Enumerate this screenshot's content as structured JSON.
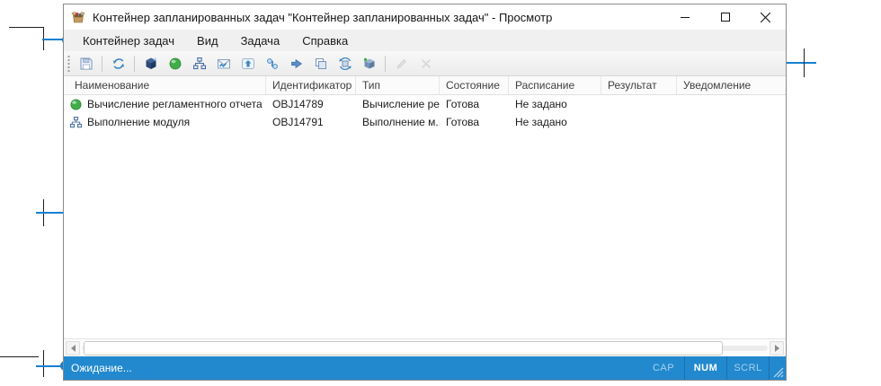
{
  "window": {
    "title": "Контейнер запланированных задач \"Контейнер запланированных задач\" - Просмотр",
    "app_icon": "open-box-icon",
    "controls": [
      "minimize",
      "maximize",
      "close"
    ]
  },
  "menu": {
    "items": [
      "Контейнер задач",
      "Вид",
      "Задача",
      "Справка"
    ]
  },
  "toolbar": {
    "icons": [
      "save-icon",
      "refresh-icon",
      "container-icon",
      "start-sphere-icon",
      "module-icon",
      "report-mail-icon",
      "export-icon",
      "links-icon",
      "run-icon",
      "copy-window-icon",
      "sync-icon",
      "package-icon",
      "edit-icon",
      "delete-icon"
    ]
  },
  "table": {
    "columns": [
      "Наименование",
      "Идентификатор",
      "Тип",
      "Состояние",
      "Расписание",
      "Результат",
      "Уведомление"
    ],
    "rows": [
      {
        "icon": "green-sphere-icon",
        "name": "Вычисление регламентного отчета",
        "id": "OBJ14789",
        "type": "Вычисление ре...",
        "state": "Готова",
        "schedule": "Не задано",
        "result": "",
        "notification": ""
      },
      {
        "icon": "module-icon",
        "name": "Выполнение модуля",
        "id": "OBJ14791",
        "type": "Выполнение м...",
        "state": "Готова",
        "schedule": "Не задано",
        "result": "",
        "notification": ""
      }
    ]
  },
  "statusbar": {
    "status_text": "Ожидание...",
    "keys": [
      {
        "label": "CAP",
        "active": false
      },
      {
        "label": "NUM",
        "active": true
      },
      {
        "label": "SCRL",
        "active": false
      }
    ]
  },
  "colors": {
    "statusbar_blue": "#2289ce",
    "callout_blue": "#1580d2",
    "icon_steel_blue": "#4f7cb4",
    "icon_green": "#3fae49"
  }
}
